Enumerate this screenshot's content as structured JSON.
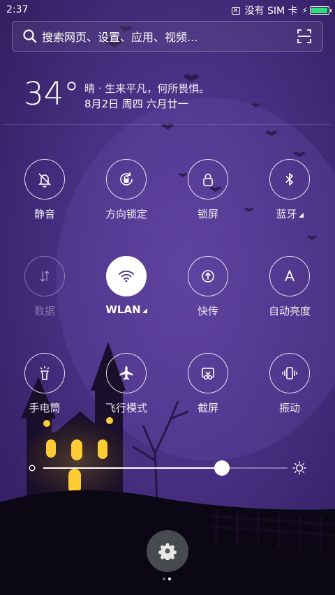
{
  "status_bar": {
    "time": "2:37",
    "sim_status": "没有 SIM 卡",
    "battery_level": 0.95,
    "battery_color": "#28e07a"
  },
  "search": {
    "placeholder": "搜索网页、设置、应用、视频..."
  },
  "weather": {
    "temperature": "34°",
    "line1": "晴 · 生来平凡，何所畏惧。",
    "line2": "8月2日 周四 六月廿一"
  },
  "toggles": [
    {
      "label": "静音",
      "icon": "bell-off-icon",
      "state": "off"
    },
    {
      "label": "方向锁定",
      "icon": "rotation-lock-icon",
      "state": "off"
    },
    {
      "label": "锁屏",
      "icon": "lock-icon",
      "state": "off"
    },
    {
      "label": "蓝牙",
      "icon": "bluetooth-icon",
      "state": "off",
      "has_submenu": true
    },
    {
      "label": "数据",
      "icon": "mobile-data-icon",
      "state": "disabled"
    },
    {
      "label": "WLAN",
      "icon": "wifi-icon",
      "state": "on",
      "has_submenu": true
    },
    {
      "label": "快传",
      "icon": "quick-transfer-icon",
      "state": "off"
    },
    {
      "label": "自动亮度",
      "icon": "auto-brightness-icon",
      "state": "off"
    },
    {
      "label": "手电筒",
      "icon": "flashlight-icon",
      "state": "off"
    },
    {
      "label": "飞行模式",
      "icon": "airplane-icon",
      "state": "off"
    },
    {
      "label": "截屏",
      "icon": "screenshot-icon",
      "state": "off"
    },
    {
      "label": "振动",
      "icon": "vibrate-icon",
      "state": "off"
    }
  ],
  "brightness": {
    "level": 0.73
  },
  "pager": {
    "pages": 2,
    "current": 2
  },
  "colors": {
    "accent": "#ffffff",
    "background": "#4d3389"
  }
}
